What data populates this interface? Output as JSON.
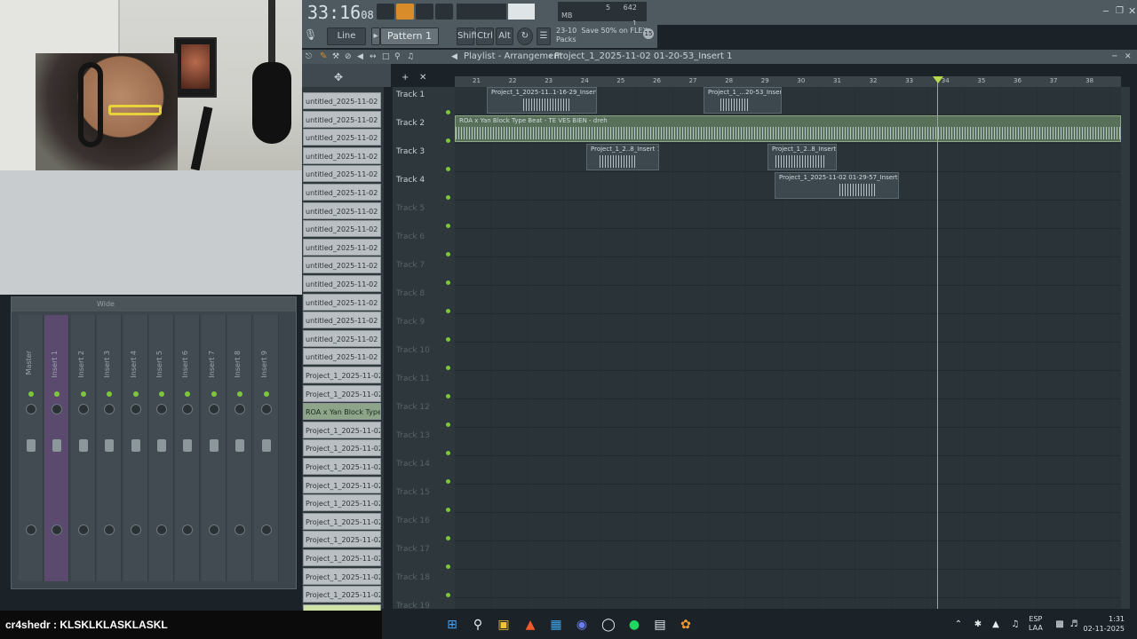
{
  "top": {
    "time_main": "33:16",
    "time_frac": "08",
    "cpu": "5",
    "memory": "642 MB",
    "voices": "1"
  },
  "toolbar": {
    "snap": "Line",
    "pattern": "Pattern 1",
    "shift": "Shift",
    "ctrl": "Ctrl",
    "alt": "Alt",
    "news_date": "23-10",
    "news_text": "Save 50% on FLEX",
    "news_sub": "Packs",
    "news_badge": "15"
  },
  "playlist": {
    "title": "Playlist - Arrangement",
    "project": "Project_1_2025-11-02 01-20-53_Insert 1",
    "ruler": [
      "21",
      "22",
      "23",
      "24",
      "25",
      "26",
      "27",
      "28",
      "29",
      "30",
      "31",
      "32",
      "33",
      "34",
      "35",
      "36",
      "37",
      "38"
    ]
  },
  "browser": {
    "items": [
      "untitled_2025-11-02 00-",
      "untitled_2025-11-02 00-",
      "untitled_2025-11-02 00-",
      "untitled_2025-11-02 00-",
      "untitled_2025-11-02 00-",
      "untitled_2025-11-02 00-",
      "untitled_2025-11-02 00-",
      "untitled_2025-11-02 00-",
      "untitled_2025-11-02 00-",
      "untitled_2025-11-02 00-",
      "untitled_2025-11-02 00-",
      "untitled_2025-11-02 00-",
      "untitled_2025-11-02 00-",
      "untitled_2025-11-02 00-",
      "untitled_2025-11-02 00-",
      "Project_1_2025-11-02 0..",
      "Project_1_2025-11-02 0..",
      "ROA x Yan Block Type",
      "Project_1_2025-11-02 0..",
      "Project_1_2025-11-02 0..",
      "Project_1_2025-11-02 0..",
      "Project_1_2025-11-02 0..",
      "Project_1_2025-11-02 0..",
      "Project_1_2025-11-02 0..",
      "Project_1_2025-11-02 0..",
      "Project_1_2025-11-02 0..",
      "Project_1_2025-11-02 0..",
      "Project_1_2025-11-02 0..",
      "Project_1_2025-11-02 0.."
    ]
  },
  "tracks": [
    "Track 1",
    "Track 2",
    "Track 3",
    "Track 4",
    "Track 5",
    "Track 6",
    "Track 7",
    "Track 8",
    "Track 9",
    "Track 10",
    "Track 11",
    "Track 12",
    "Track 13",
    "Track 14",
    "Track 15",
    "Track 16",
    "Track 17",
    "Track 18",
    "Track 19"
  ],
  "clips": {
    "c1": "Project_1_2025-11..1-16-29_Insert 1",
    "c2": "Project_1_...20-53_Insert 1",
    "c3": "ROA x Yan Block Type Beat - TE VES BIEN - dreh",
    "c4": "Project_1_2..8_Insert 1",
    "c5": "Project_1_2..8_Insert 1",
    "c6": "Project_1_2025-11-02 01-29-57_Insert 1"
  },
  "mixer": {
    "title": "Wide",
    "strips": [
      "Master",
      "Insert 1",
      "Insert 2",
      "Insert 3",
      "Insert 4",
      "Insert 5",
      "Insert 6",
      "Insert 7",
      "Insert 8",
      "Insert 9"
    ],
    "numbers": [
      "C",
      "M",
      "1",
      "2",
      "3",
      "4",
      "5",
      "6",
      "7",
      "8",
      "9"
    ]
  },
  "chat": {
    "user": "cr4shedr",
    "message": "KLSKLKLASKLASKL"
  },
  "system": {
    "lang1": "ESP",
    "lang2": "LAA",
    "time": "1:31",
    "date": "02-11-2025"
  }
}
